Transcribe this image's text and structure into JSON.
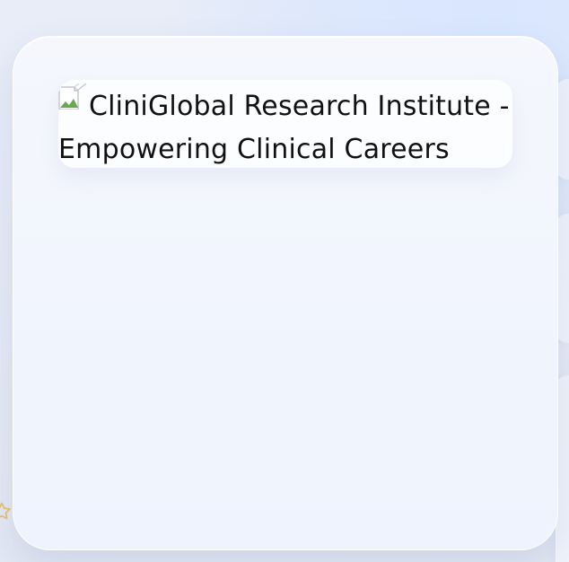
{
  "logo": {
    "text": "CliniGlobal Research Institute - Empowering Clinical Careers",
    "icon": "broken-image-icon"
  },
  "decor": {
    "star_icon": "star-icon",
    "accent": "#e3c46d"
  }
}
